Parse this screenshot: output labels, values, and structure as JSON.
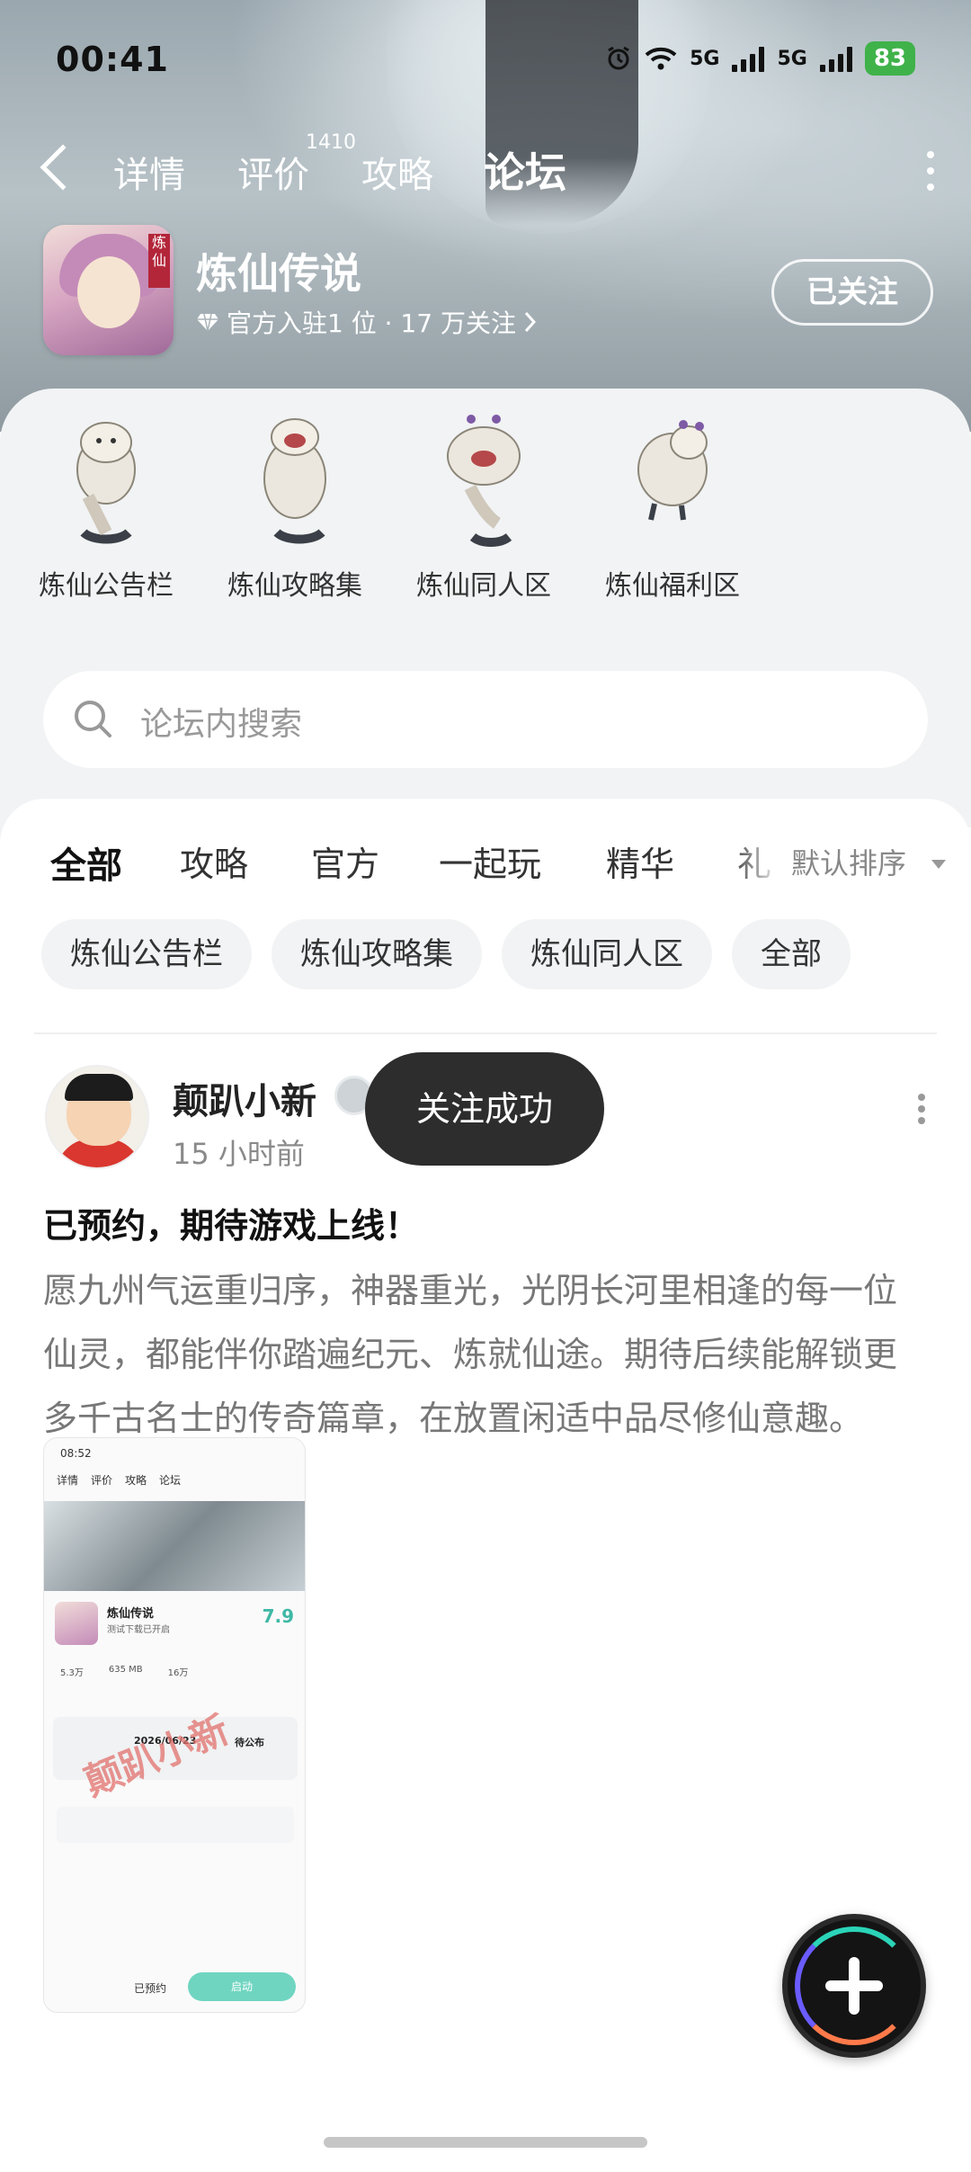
{
  "status": {
    "time": "00:41",
    "net1": "5G",
    "net2": "5G",
    "battery": "83"
  },
  "nav": {
    "tabs": [
      "详情",
      "评价",
      "攻略",
      "论坛"
    ],
    "review_count": "1410",
    "active": "论坛"
  },
  "game": {
    "name": "炼仙传说",
    "meta": "官方入驻1 位 · 17 万关注",
    "follow_label": "已关注",
    "icon_tag": "炼仙"
  },
  "boards": [
    "炼仙公告栏",
    "炼仙攻略集",
    "炼仙同人区",
    "炼仙福利区"
  ],
  "search": {
    "placeholder": "论坛内搜索"
  },
  "filter": {
    "tabs": [
      "全部",
      "攻略",
      "官方",
      "一起玩",
      "精华",
      "礼"
    ],
    "sort_label": "默认排序",
    "chips": [
      "炼仙公告栏",
      "炼仙攻略集",
      "炼仙同人区",
      "全部"
    ]
  },
  "post": {
    "author": "颠趴小新",
    "time": "15 小时前",
    "toast": "关注成功",
    "title": "已预约，期待游戏上线！",
    "body": "愿九州气运重归序，神器重光，光阴长河里相逢的每一位仙灵，都能伴你踏遍纪元、炼就仙途。期待后续能解锁更多千古名士的传奇篇章，在放置闲适中品尽修仙意趣。",
    "image": {
      "time": "08:52",
      "tabs": [
        "详情",
        "评价",
        "攻略",
        "论坛"
      ],
      "name": "炼仙传说",
      "subtitle": "测试下载已开启",
      "score": "7.9",
      "stats": [
        "5.3万",
        "635 MB",
        "16万"
      ],
      "date": "2026/06/23",
      "tbd": "待公布",
      "book": "已预约",
      "start": "启动",
      "watermark": "颠趴小新"
    }
  },
  "colors": {
    "accent": "#49d3b4",
    "toast_bg": "#2d2d2d"
  }
}
